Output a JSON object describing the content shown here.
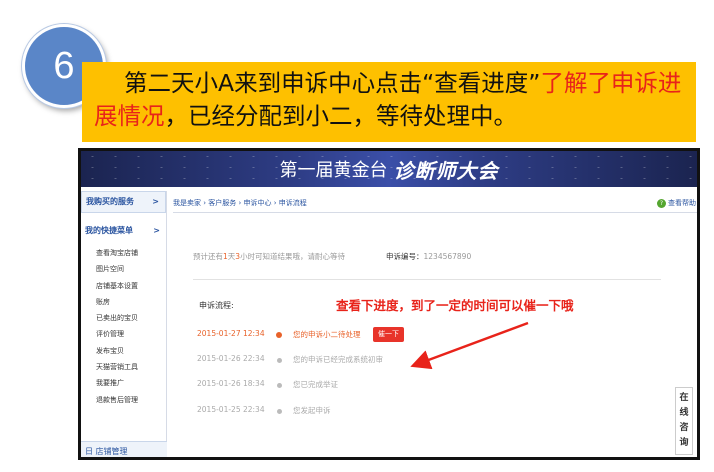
{
  "step": {
    "number": "6"
  },
  "caption": {
    "part1": "第二天小A来到申诉中心点击“查看进度”",
    "part2": "了解了申诉进展情况",
    "part3": "，已经分配到小二，等待处理中。"
  },
  "header": {
    "title_a": "第一届黄金台",
    "title_b": "诊断师大会"
  },
  "sidebar": {
    "purchased_services": "我购买的服务",
    "quick_menu": "我的快捷菜单",
    "arrow": ">",
    "items": [
      "查看淘宝店铺",
      "图片空间",
      "店铺基本设置",
      "账房",
      "已卖出的宝贝",
      "评价管理",
      "发布宝贝",
      "天猫营销工具",
      "我要推广",
      "退款售后管理"
    ],
    "footer": "日 店铺管理"
  },
  "breadcrumb": {
    "text": "我是卖家 › 客户服务 › 申诉中心 › 申诉流程"
  },
  "help": {
    "icon": "?",
    "label": "查看帮助"
  },
  "notice": {
    "prefix": "预计还有",
    "a": "1",
    "mid1": "天",
    "b": "3",
    "suffix": "小时可知道结果哦，请耐心等待"
  },
  "complaint": {
    "label": "申诉编号：",
    "value": "1234567890"
  },
  "flow": {
    "label": "申诉流程:",
    "annotation": "查看下进度，到了一定的时间可以催一下哦",
    "urge_button": "催一下",
    "events": [
      {
        "time": "2015-01-27 12:34",
        "desc": "您的申诉小二待处理"
      },
      {
        "time": "2015-01-26 22:34",
        "desc": "您的申诉已经完成系统初审"
      },
      {
        "time": "2015-01-26 18:34",
        "desc": "您已完成举证"
      },
      {
        "time": "2015-01-25 22:34",
        "desc": "您发起申诉"
      }
    ]
  },
  "online_consult": {
    "chars": [
      "在",
      "线",
      "咨",
      "询"
    ]
  },
  "colors": {
    "banner": "#fec000",
    "highlight": "#e8231a",
    "step_circle": "#5a86c8",
    "link": "#2b55a0"
  }
}
